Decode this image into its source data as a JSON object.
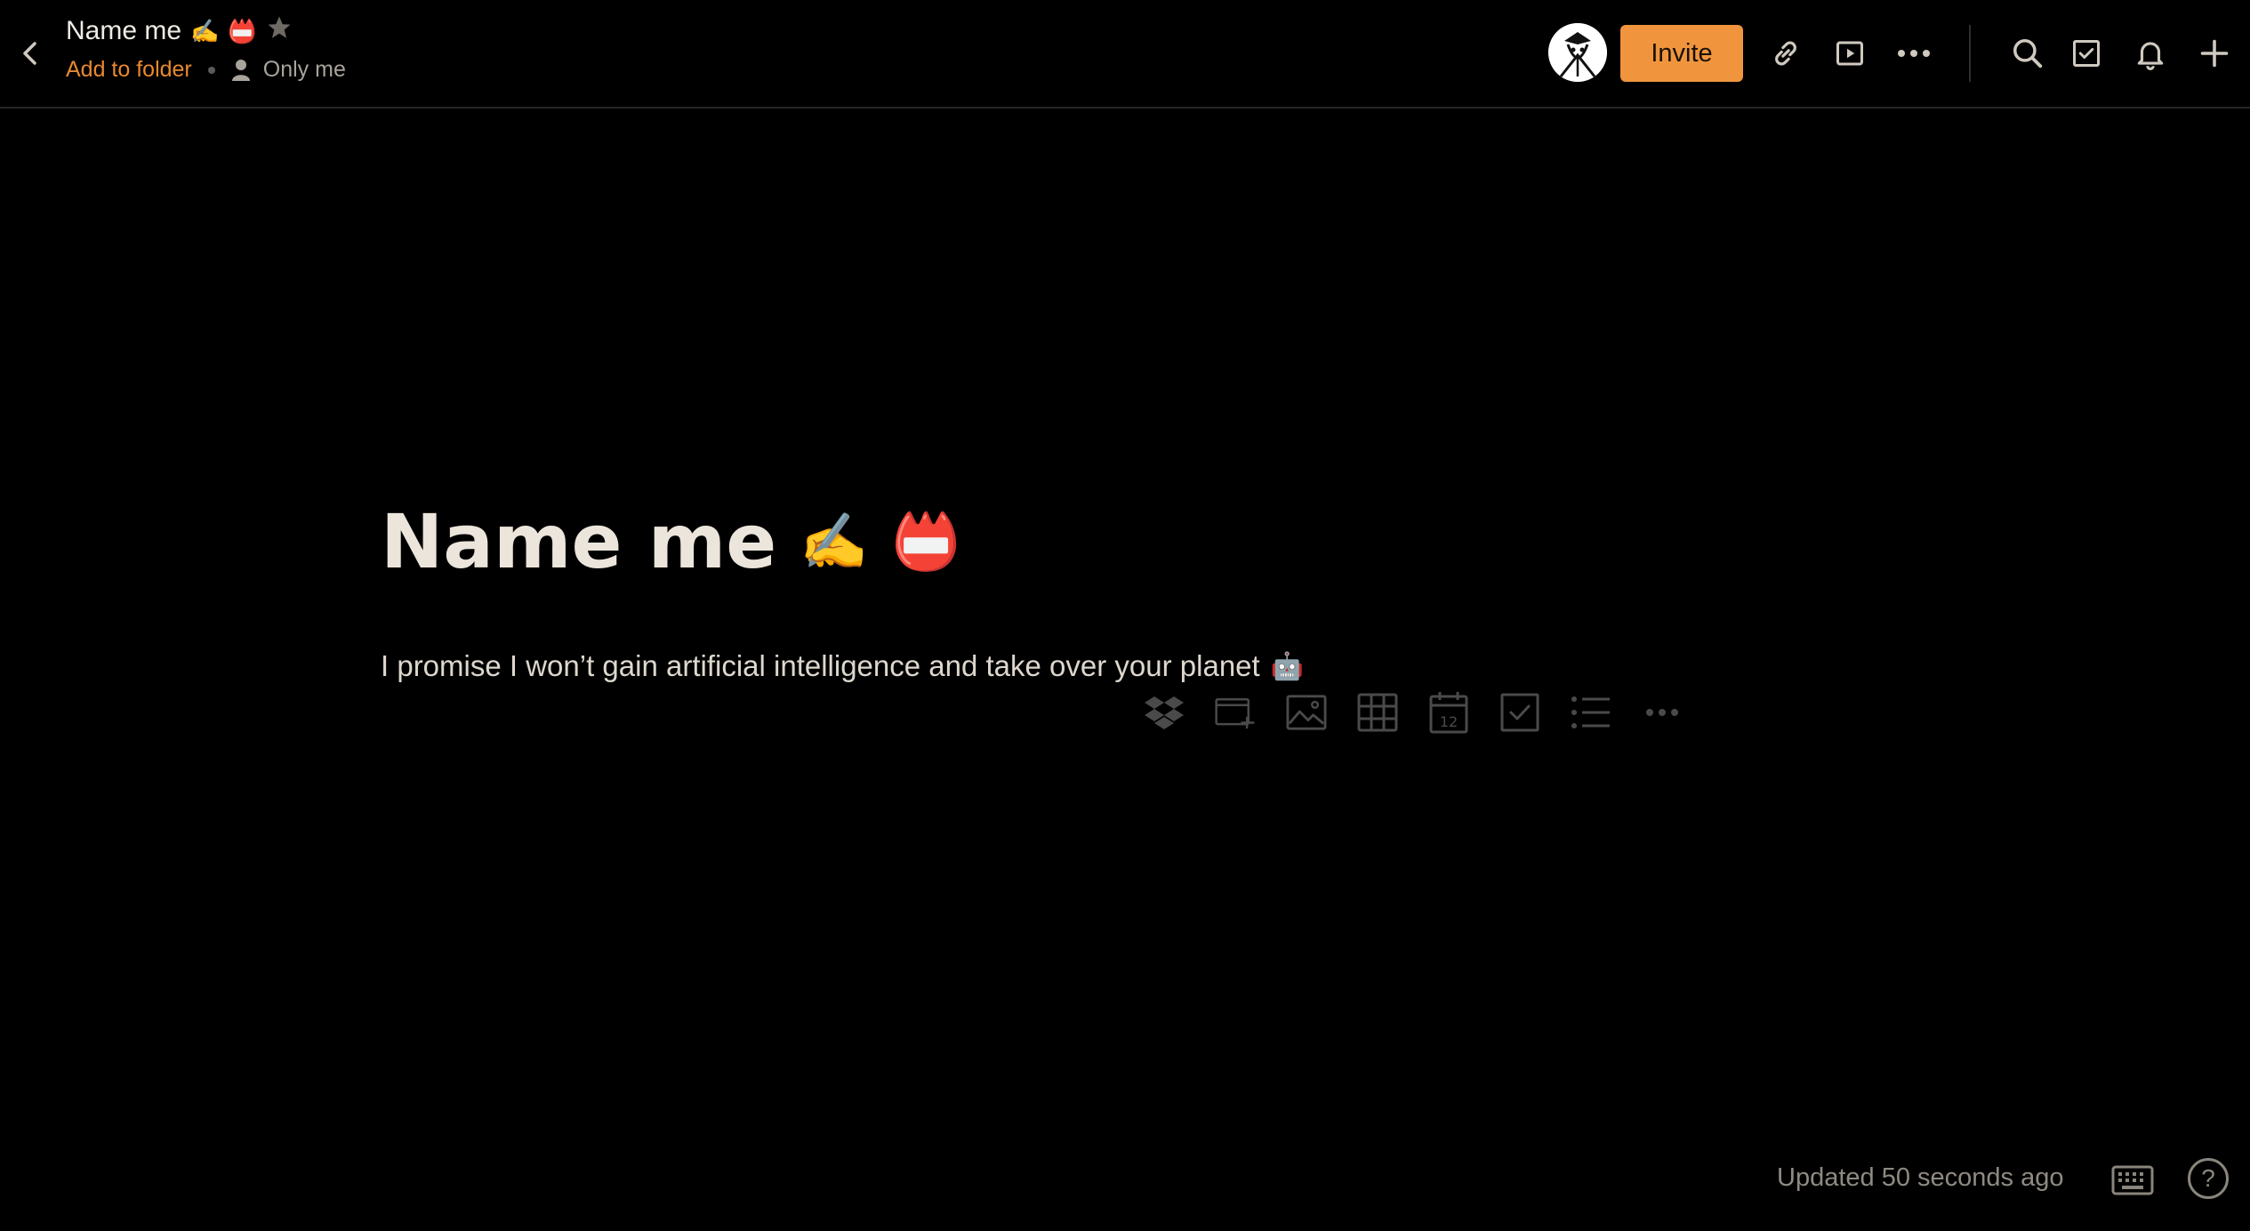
{
  "header": {
    "doc_title": "Name me",
    "title_emoji_1": "✍️",
    "title_emoji_2": "📛",
    "add_to_folder": "Add to folder",
    "sharing": "Only me",
    "invite_label": "Invite"
  },
  "icons": {
    "back": "chevron-left-icon",
    "star": "star-icon",
    "person": "person-icon",
    "avatar": "avatar",
    "link": "link-icon",
    "present": "play-icon",
    "more": "more-icon",
    "search": "search-icon",
    "tasks": "checkbox-icon",
    "notifications": "bell-icon",
    "add": "plus-icon"
  },
  "document": {
    "heading": "Name me",
    "heading_emoji_1": "✍️",
    "heading_emoji_2": "📛",
    "body": "I promise I won’t gain artificial intelligence and take over your planet",
    "body_emoji": "🤖"
  },
  "insert_toolbar": [
    "dropbox-icon",
    "add-media-icon",
    "image-icon",
    "table-icon",
    "calendar-icon",
    "checkbox-icon",
    "bulleted-list-icon",
    "more-icon"
  ],
  "calendar_day": "12",
  "footer": {
    "status": "Updated 50 seconds ago",
    "help_glyph": "?"
  },
  "colors": {
    "background": "#000000",
    "accent": "#f0953e",
    "link": "#e8892e",
    "text": "#ebe5db",
    "muted": "#8f8a82"
  }
}
